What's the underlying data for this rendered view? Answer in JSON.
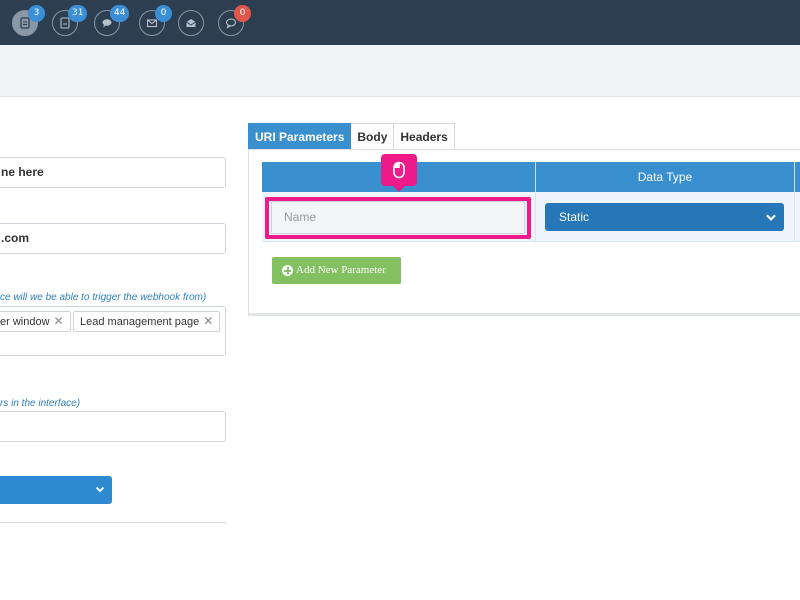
{
  "topbar": {
    "icons": [
      {
        "name": "document-icon",
        "badge": "3",
        "badge_color": "#3b8fd6"
      },
      {
        "name": "file-icon",
        "badge": "31",
        "badge_color": "#3b8fd6"
      },
      {
        "name": "chat-icon",
        "badge": "44",
        "badge_color": "#3b8fd6"
      },
      {
        "name": "mail-icon",
        "badge": "0",
        "badge_color": "#3b8fd6"
      },
      {
        "name": "open-mail-icon",
        "badge": "",
        "badge_color": ""
      },
      {
        "name": "comment-icon",
        "badge": "0",
        "badge_color": "#e2574c"
      }
    ]
  },
  "left_form": {
    "name_value": "ne here",
    "url_value": ".com",
    "where_hint": "ce will we be able to trigger the webhook from)",
    "tags": [
      "er window",
      "Lead management page"
    ],
    "interface_hint": "rs in the interface)",
    "interface_value": ""
  },
  "tabs": [
    {
      "label": "URI Parameters",
      "active": true
    },
    {
      "label": "Body",
      "active": false
    },
    {
      "label": "Headers",
      "active": false
    }
  ],
  "table": {
    "columns": [
      "",
      "Data Type"
    ],
    "row": {
      "name_placeholder": "Name",
      "data_type": "Static"
    }
  },
  "add_button_label": "Add New Parameter",
  "colors": {
    "accent": "#3a8fcf",
    "highlight": "#ef1a8a",
    "add_button": "#83c062",
    "topbar": "#2d3e50"
  }
}
